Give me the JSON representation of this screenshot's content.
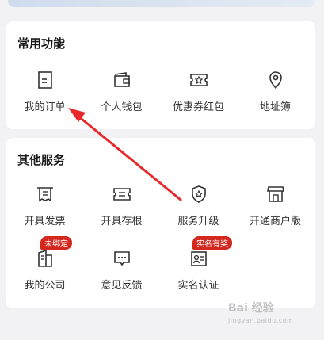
{
  "common": {
    "title": "常用功能",
    "items": [
      {
        "label": "我的订单",
        "icon": "order-icon"
      },
      {
        "label": "个人钱包",
        "icon": "wallet-icon"
      },
      {
        "label": "优惠券红包",
        "icon": "coupon-icon"
      },
      {
        "label": "地址簿",
        "icon": "location-pin-icon"
      }
    ]
  },
  "other": {
    "title": "其他服务",
    "items": [
      {
        "label": "开具发票",
        "icon": "invoice-icon"
      },
      {
        "label": "开具存根",
        "icon": "stub-ticket-icon"
      },
      {
        "label": "服务升级",
        "icon": "upgrade-shield-icon"
      },
      {
        "label": "开通商户版",
        "icon": "storefront-icon"
      },
      {
        "label": "我的公司",
        "icon": "company-building-icon",
        "badge": "未绑定"
      },
      {
        "label": "意见反馈",
        "icon": "feedback-chat-icon"
      },
      {
        "label": "实名认证",
        "icon": "id-card-icon",
        "badge": "实名有奖"
      }
    ]
  },
  "watermark": {
    "text": "Bai 经验",
    "sub": "jingyan.baidu.com"
  },
  "colors": {
    "accent": "#d4281e",
    "annotation_arrow": "#e8292b",
    "icon_stroke": "#333333"
  }
}
